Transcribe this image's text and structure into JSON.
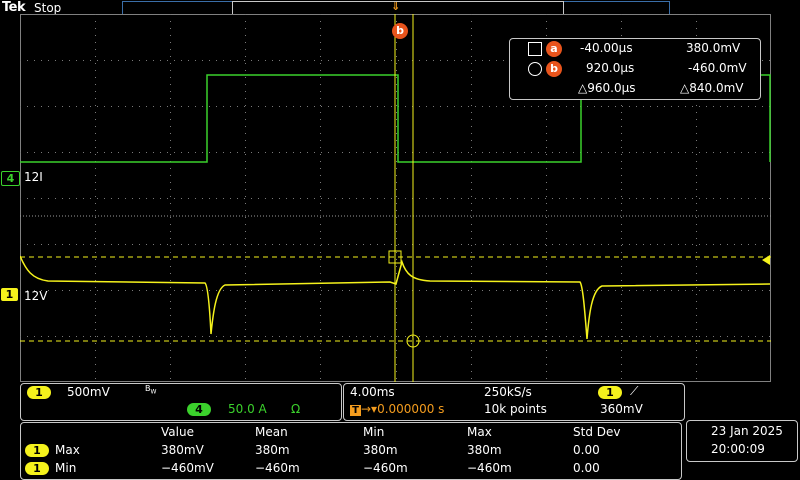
{
  "header": {
    "brand": "Tek",
    "acquisition_status": "Stop"
  },
  "colors": {
    "ch1": "#f5f21c",
    "ch4": "#3bd12c",
    "cursor_badge": "#e8541c",
    "grid": "#808080"
  },
  "channels": {
    "ch1": {
      "number": "1",
      "label": "12V"
    },
    "ch4": {
      "number": "4",
      "label": "12I"
    }
  },
  "cursors": {
    "a_label": "a",
    "b_label": "b",
    "a_time": "-40.00µs",
    "a_value": "380.0mV",
    "b_time": "920.0µs",
    "b_value": "-460.0mV",
    "delta_time": "△960.0µs",
    "delta_value": "△840.0mV"
  },
  "vertical": {
    "ch1_number": "1",
    "ch1_scale": "500mV",
    "bw_icon": "bandwidth-limit-icon",
    "ch4_number": "4",
    "ch4_scale": "50.0 A",
    "ch4_coupling_icon": "ohm-icon"
  },
  "horizontal": {
    "time_div": "4.00ms",
    "sample_rate": "250kS/s",
    "trigger_channel": "1",
    "trigger_position": "0.000000 s",
    "record_length": "10k points",
    "trigger_level": "360mV"
  },
  "measurements": {
    "headers": [
      "Value",
      "Mean",
      "Min",
      "Max",
      "Std Dev"
    ],
    "rows": [
      {
        "channel": "1",
        "name": "Max",
        "value": "380mV",
        "mean": "380m",
        "min": "380m",
        "max": "380m",
        "std": "0.00"
      },
      {
        "channel": "1",
        "name": "Min",
        "value": "−460mV",
        "mean": "−460m",
        "min": "−460m",
        "max": "−460m",
        "std": "0.00"
      }
    ]
  },
  "datetime": {
    "date": "23 Jan  2025",
    "time": "20:00:09"
  }
}
